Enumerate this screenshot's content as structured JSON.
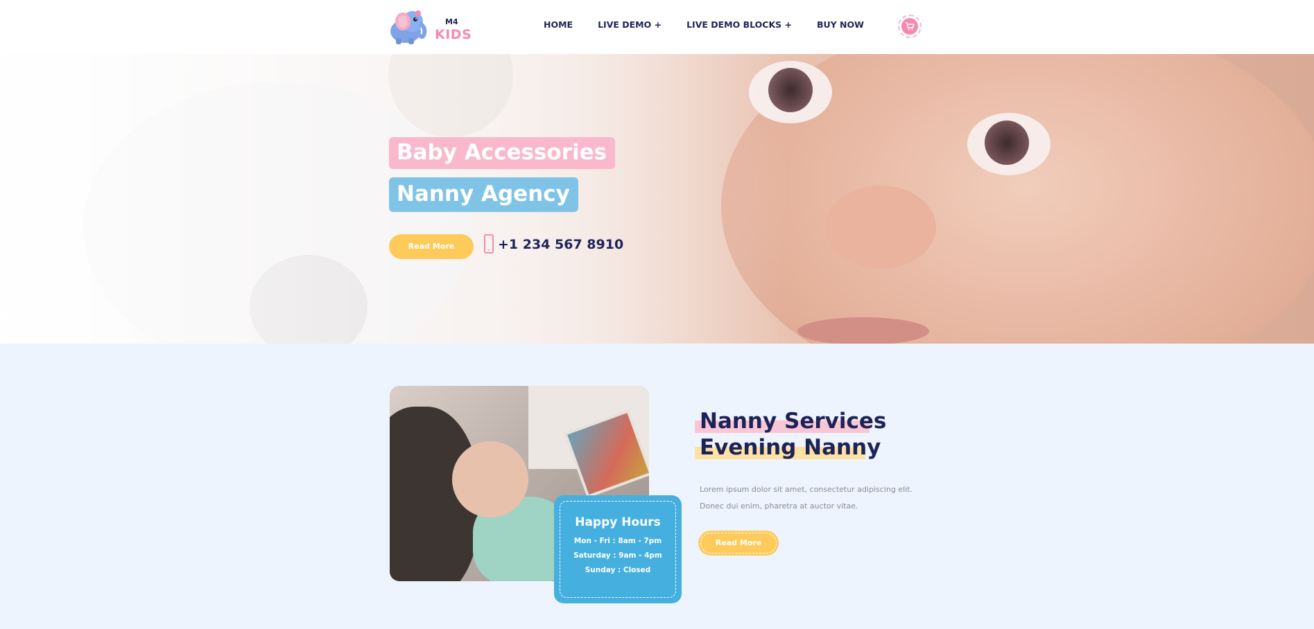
{
  "header": {
    "logo": {
      "top": "M4",
      "bottom": "KIDS"
    },
    "nav": [
      {
        "label": "HOME"
      },
      {
        "label": "LIVE DEMO +"
      },
      {
        "label": "LIVE DEMO BLOCKS +"
      },
      {
        "label": "BUY NOW"
      }
    ],
    "cart_icon": "cart-icon"
  },
  "hero": {
    "tag1": "Baby Accessories",
    "tag2": "Nanny Agency",
    "button": "Read More",
    "phone_icon": "mobile-phone-icon",
    "phone": "+1 234 567 8910"
  },
  "services": {
    "title1": "Nanny Services",
    "title2": "Evening Nanny",
    "text_line1": "Lorem ipsum dolor sit amet, consectetur adipiscing elit.",
    "text_line2": "Donec dui enim, pharetra at auctor vitae.",
    "button": "Read More",
    "hours": {
      "title": "Happy Hours",
      "lines": [
        "Mon - Fri : 8am - 7pm",
        "Saturday : 9am - 4pm",
        "Sunday : Closed"
      ]
    }
  },
  "colors": {
    "navy": "#1d2357",
    "pink": "#f589b0",
    "light_pink": "#f9b8cc",
    "blue": "#7fc4e6",
    "hours_blue": "#45b0df",
    "yellow": "#fecb5b",
    "section_bg": "#eef4fd"
  }
}
